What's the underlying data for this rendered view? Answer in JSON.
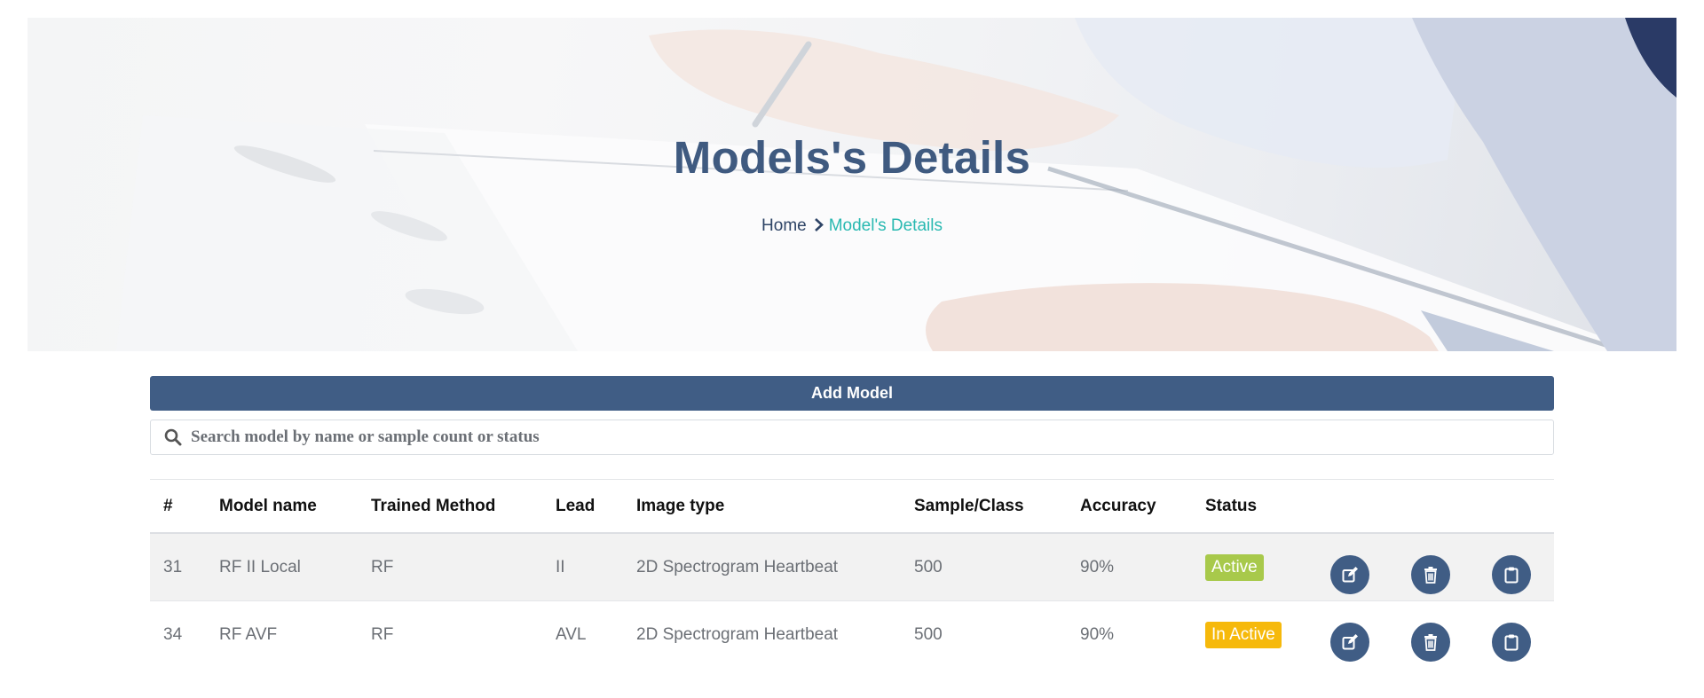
{
  "hero": {
    "title": "Models's Details",
    "breadcrumb": {
      "home": "Home",
      "current": "Model's Details"
    }
  },
  "toolbar": {
    "add_label": "Add Model"
  },
  "search": {
    "placeholder": "Search model by name or sample count or status",
    "value": ""
  },
  "table": {
    "columns": [
      "#",
      "Model name",
      "Trained Method",
      "Lead",
      "Image type",
      "Sample/Class",
      "Accuracy",
      "Status"
    ],
    "rows": [
      {
        "id": "31",
        "name": "RF II Local",
        "method": "RF",
        "lead": "II",
        "image_type": "2D Spectrogram Heartbeat",
        "samples": "500",
        "accuracy": "90%",
        "status": "Active",
        "status_color": "#a8c94b"
      },
      {
        "id": "34",
        "name": "RF AVF",
        "method": "RF",
        "lead": "AVL",
        "image_type": "2D Spectrogram Heartbeat",
        "samples": "500",
        "accuracy": "90%",
        "status": "In Active",
        "status_color": "#f6b90b"
      }
    ],
    "actions": [
      "edit-icon",
      "trash-icon",
      "clipboard-icon"
    ]
  },
  "colors": {
    "primary": "#405d85",
    "accent": "#29b9b1",
    "active": "#a8c94b",
    "inactive": "#f6b90b"
  }
}
